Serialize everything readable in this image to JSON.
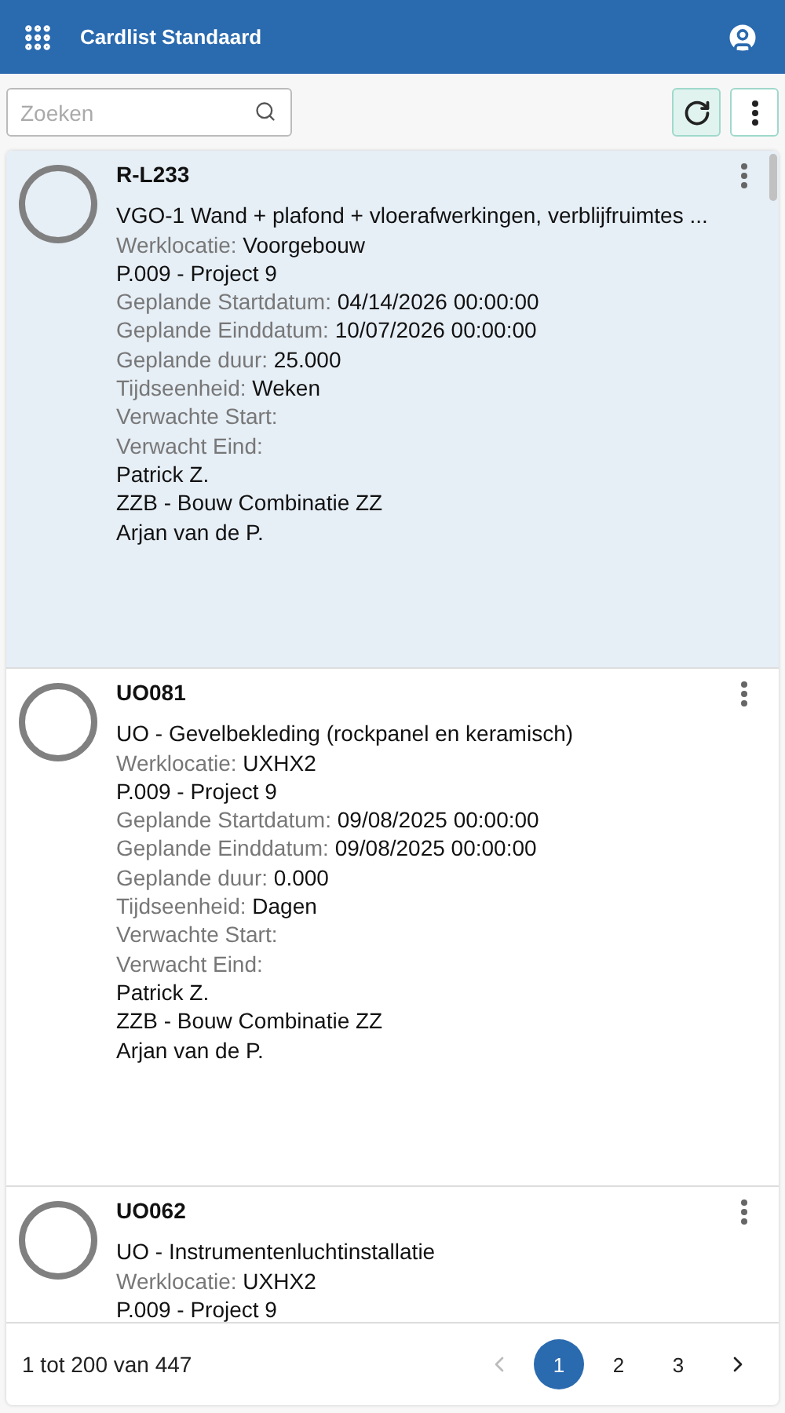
{
  "header": {
    "title": "Cardlist Standaard"
  },
  "search": {
    "placeholder": "Zoeken"
  },
  "cards": [
    {
      "code": "R-L233",
      "selected": true,
      "title": "VGO-1 Wand + plafond + vloerafwerkingen, verblijfruimtes ...",
      "lines": [
        {
          "kind": "field",
          "label": "Werklocatie:",
          "value": "Voorgebouw"
        },
        {
          "kind": "plain",
          "value": "P.009 - Project 9"
        },
        {
          "kind": "field",
          "label": "Geplande Startdatum:",
          "value": "04/14/2026 00:00:00"
        },
        {
          "kind": "field",
          "label": "Geplande Einddatum:",
          "value": "10/07/2026 00:00:00"
        },
        {
          "kind": "field",
          "label": "Geplande duur:",
          "value": "25.000"
        },
        {
          "kind": "field",
          "label": "Tijdseenheid:",
          "value": "Weken"
        },
        {
          "kind": "field",
          "label": "Verwachte Start:"
        },
        {
          "kind": "field",
          "label": "Verwacht Eind:"
        },
        {
          "kind": "plain",
          "value": "Patrick Z."
        },
        {
          "kind": "plain",
          "value": "ZZB - Bouw Combinatie ZZ"
        },
        {
          "kind": "plain",
          "value": "Arjan van de P."
        }
      ]
    },
    {
      "code": "UO081",
      "selected": false,
      "title": "UO - Gevelbekleding (rockpanel en keramisch)",
      "lines": [
        {
          "kind": "field",
          "label": "Werklocatie:",
          "value": "UXHX2"
        },
        {
          "kind": "plain",
          "value": "P.009 - Project 9"
        },
        {
          "kind": "field",
          "label": "Geplande Startdatum:",
          "value": "09/08/2025 00:00:00"
        },
        {
          "kind": "field",
          "label": "Geplande Einddatum:",
          "value": "09/08/2025 00:00:00"
        },
        {
          "kind": "field",
          "label": "Geplande duur:",
          "value": "0.000"
        },
        {
          "kind": "field",
          "label": "Tijdseenheid:",
          "value": "Dagen"
        },
        {
          "kind": "field",
          "label": "Verwachte Start:"
        },
        {
          "kind": "field",
          "label": "Verwacht Eind:"
        },
        {
          "kind": "plain",
          "value": "Patrick Z."
        },
        {
          "kind": "plain",
          "value": "ZZB - Bouw Combinatie ZZ"
        },
        {
          "kind": "plain",
          "value": "Arjan van de P."
        }
      ]
    },
    {
      "code": "UO062",
      "selected": false,
      "title": "UO - Instrumentenluchtinstallatie",
      "lines": [
        {
          "kind": "field",
          "label": "Werklocatie:",
          "value": "UXHX2"
        },
        {
          "kind": "plain",
          "value": "P.009 - Project 9"
        }
      ]
    }
  ],
  "footer": {
    "range": "1 tot 200 van 447",
    "prev_disabled": true,
    "pages": [
      {
        "label": "1",
        "selected": true
      },
      {
        "label": "2",
        "selected": false
      },
      {
        "label": "3",
        "selected": false
      }
    ]
  }
}
